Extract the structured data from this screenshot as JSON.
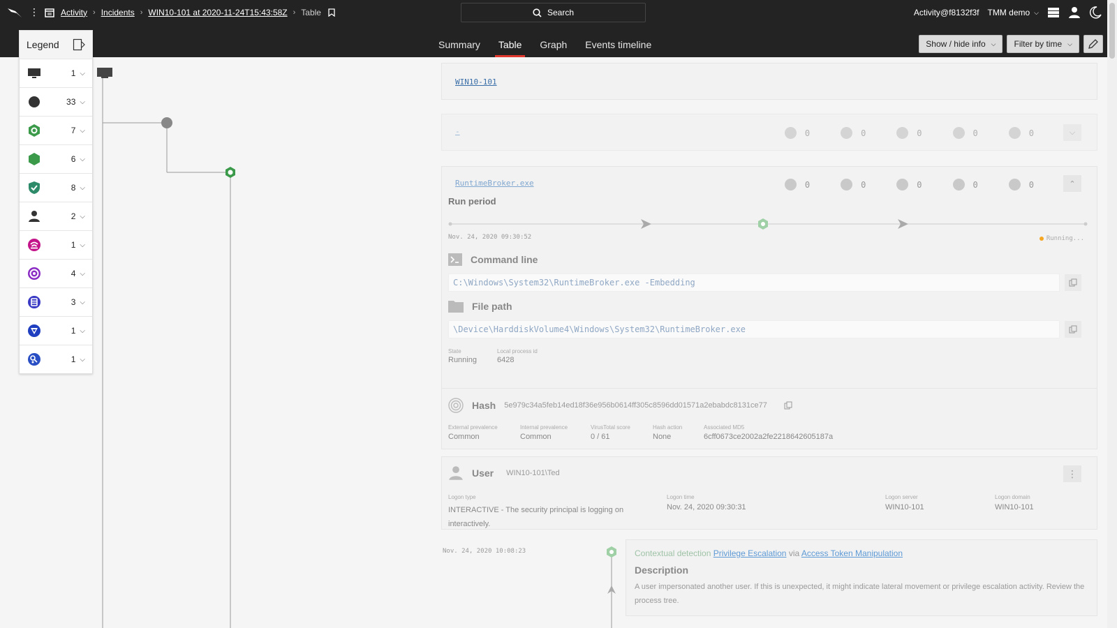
{
  "breadcrumb": {
    "items": [
      "Activity",
      "Incidents",
      "WIN10-101 at 2020-11-24T15:43:58Z"
    ],
    "current": "Table"
  },
  "search": {
    "label": "Search"
  },
  "account": {
    "user": "Activity@f8132f3f",
    "tenant": "TMM demo"
  },
  "tabs": [
    "Summary",
    "Table",
    "Graph",
    "Events timeline"
  ],
  "active_tab": "Table",
  "toolbar": {
    "show_hide": "Show / hide info",
    "filter_time": "Filter by time"
  },
  "legend": {
    "title": "Legend",
    "rows": [
      {
        "icon": "computer-icon",
        "count": "1"
      },
      {
        "icon": "process-icon",
        "count": "33"
      },
      {
        "icon": "detection-outline-icon",
        "count": "7"
      },
      {
        "icon": "detection-filled-icon",
        "count": "6"
      },
      {
        "icon": "shield-check-icon",
        "count": "8"
      },
      {
        "icon": "user-icon",
        "count": "2"
      },
      {
        "icon": "network-icon",
        "count": "1"
      },
      {
        "icon": "target-icon",
        "count": "4"
      },
      {
        "icon": "registry-icon",
        "count": "3"
      },
      {
        "icon": "triangle-icon",
        "count": "1"
      },
      {
        "icon": "dns-icon",
        "count": "1"
      }
    ]
  },
  "host": {
    "name": "WIN10-101"
  },
  "node1": {
    "name": "-",
    "stats": [
      "0",
      "0",
      "0",
      "0",
      "0"
    ]
  },
  "process": {
    "name": "RuntimeBroker.exe",
    "stats": [
      "0",
      "0",
      "0",
      "0",
      "0"
    ],
    "run_period": "Run period",
    "start": "Nov. 24, 2020 09:30:52",
    "status": "Running...",
    "cmd_title": "Command line",
    "cmd": "C:\\Windows\\System32\\RuntimeBroker.exe -Embedding",
    "path_title": "File path",
    "path": "\\Device\\HarddiskVolume4\\Windows\\System32\\RuntimeBroker.exe",
    "state_label": "State",
    "state": "Running",
    "pid_label": "Local process id",
    "pid": "6428"
  },
  "hash": {
    "title": "Hash",
    "value": "5e979c34a5feb14ed18f36e956b0614ff305c8596dd01571a2ebabdc8131ce77",
    "fields": [
      {
        "label": "External prevalence",
        "value": "Common"
      },
      {
        "label": "Internal prevalence",
        "value": "Common"
      },
      {
        "label": "VirusTotal score",
        "value": "0 / 61"
      },
      {
        "label": "Hash action",
        "value": "None"
      },
      {
        "label": "Associated MD5",
        "value": "6cff0673ce2002a2fe2218642605187a"
      }
    ]
  },
  "user": {
    "title": "User",
    "value": "WIN10-101\\Ted",
    "fields": [
      {
        "label": "Logon type",
        "value": "INTERACTIVE - The security principal is logging on interactively."
      },
      {
        "label": "Logon time",
        "value": "Nov. 24, 2020 09:30:31"
      },
      {
        "label": "Logon server",
        "value": "WIN10-101"
      },
      {
        "label": "Logon domain",
        "value": "WIN10-101"
      }
    ]
  },
  "detection": {
    "time": "Nov. 24, 2020 10:08:23",
    "prefix": "Contextual detection",
    "tactic": "Privilege Escalation",
    "via": "via",
    "technique": "Access Token Manipulation",
    "desc_title": "Description",
    "desc": "A user impersonated another user. If this is unexpected, it might indicate lateral movement or privilege escalation activity. Review the process tree."
  },
  "colors": {
    "accent": "#e0382c",
    "green": "#3a9a4a",
    "teal": "#2e8b6a",
    "magenta": "#c4148a",
    "purple": "#8a2bc4",
    "blue": "#2a4fc4"
  }
}
